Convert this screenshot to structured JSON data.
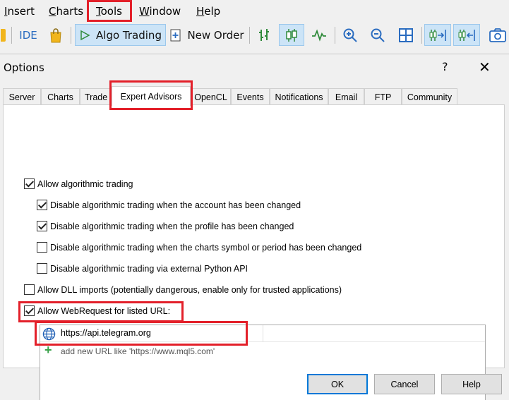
{
  "menu": {
    "insert": {
      "first": "I",
      "rest": "nsert"
    },
    "charts": {
      "first": "C",
      "rest": "harts"
    },
    "tools": {
      "first": "T",
      "rest": "ools"
    },
    "window": {
      "first": "W",
      "rest": "indow"
    },
    "help": {
      "first": "H",
      "rest": "elp"
    }
  },
  "toolbar": {
    "ide_label": "IDE",
    "algo_trading_label": "Algo Trading",
    "new_order_label": "New Order"
  },
  "dialog": {
    "title": "Options",
    "help_glyph": "?",
    "close_glyph": "✕",
    "tabs": [
      {
        "label": "Server"
      },
      {
        "label": "Charts"
      },
      {
        "label": "Trade"
      },
      {
        "label": "Expert Advisors"
      },
      {
        "label": "OpenCL"
      },
      {
        "label": "Events"
      },
      {
        "label": "Notifications"
      },
      {
        "label": "Email"
      },
      {
        "label": "FTP"
      },
      {
        "label": "Community"
      }
    ],
    "selected_tab": "Expert Advisors",
    "options": {
      "allow_algo": {
        "label": "Allow algorithmic trading",
        "checked": true
      },
      "disable_account": {
        "label": "Disable algorithmic trading when the account has been changed",
        "checked": true
      },
      "disable_profile": {
        "label": "Disable algorithmic trading when the profile has been changed",
        "checked": true
      },
      "disable_symbol": {
        "label": "Disable algorithmic trading when the charts symbol or period has been changed",
        "checked": false
      },
      "disable_python": {
        "label": "Disable algorithmic trading via external Python API",
        "checked": false
      },
      "allow_dll": {
        "label": "Allow DLL imports (potentially dangerous, enable only for trusted applications)",
        "checked": false
      },
      "allow_webrequest": {
        "label": "Allow WebRequest for listed URL:",
        "checked": true
      }
    },
    "url_list": {
      "urls": [
        "https://api.telegram.org"
      ],
      "add_placeholder": "add new URL like 'https://www.mql5.com'"
    },
    "buttons": {
      "ok": "OK",
      "cancel": "Cancel",
      "help": "Help"
    }
  },
  "colors": {
    "highlight": "#e3202a",
    "accent": "#0078d7",
    "active_button": "#cce4f7",
    "add_icon": "#3aa24a"
  }
}
